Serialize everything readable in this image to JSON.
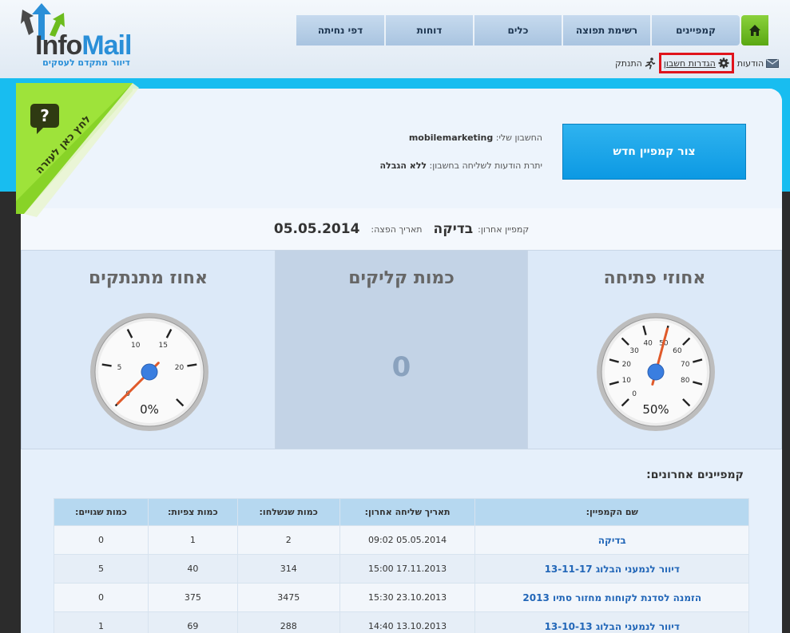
{
  "logo": {
    "word_a": "Info",
    "word_b": "Mail",
    "tagline": "דיוור מתקדם לעסקים"
  },
  "colors": {
    "accent": "#18bdf0",
    "home_green": "#6cbc1e",
    "nav_blue": "#b3cce6",
    "highlight": "#e0141c"
  },
  "nav": {
    "home_icon": "home-icon",
    "items": [
      "קמפיינים",
      "רשימת תפוצה",
      "כלים",
      "דוחות",
      "דפי נחיתה"
    ]
  },
  "subnav": {
    "messages": "הודעות",
    "settings": "הגדרות חשבון",
    "logout": "התנתק"
  },
  "help": {
    "label": "לחץ כאן לעזרה",
    "icon_glyph": "?"
  },
  "account": {
    "new_campaign": "צור קמפיין חדש",
    "account_label": "החשבון שלי:",
    "account_value": "mobilemarketing",
    "remaining_label": "יתרת הודעות לשליחה בחשבון:",
    "remaining_value": "ללא הגבלה"
  },
  "last_campaign": {
    "label": "קמפיין אחרון:",
    "name": "בדיקה",
    "date_label": "תאריך הפצה:",
    "date": "05.05.2014"
  },
  "stats": {
    "open": {
      "title": "אחוזי פתיחה",
      "display": "50%",
      "value": 50,
      "ticks": [
        "0",
        "10",
        "20",
        "30",
        "40",
        "50",
        "60",
        "70",
        "80"
      ]
    },
    "clicks": {
      "title": "כמות קליקים",
      "value": "0"
    },
    "unsub": {
      "title": "אחוז מתנתקים",
      "display": "0%",
      "value": 0,
      "ticks": [
        "0",
        "5",
        "10",
        "15",
        "20"
      ]
    }
  },
  "recent": {
    "title": "קמפיינים אחרונים:",
    "headers": [
      "שם הקמפיין:",
      "תאריך שליחה אחרון:",
      "כמות שנשלחו:",
      "כמות צפיות:",
      "כמות שגויים:"
    ],
    "rows": [
      [
        "בדיקה",
        "05.05.2014 09:02",
        "2",
        "1",
        "0"
      ],
      [
        "דיוור לנמעני הבלוג 13-11-17",
        "17.11.2013 15:00",
        "314",
        "40",
        "5"
      ],
      [
        "הזמנה לסדנת לקוחות מחזור סתיו 2013",
        "23.10.2013 15:30",
        "3475",
        "375",
        "0"
      ],
      [
        "דיוור לנמעני הבלוג 13-10-13",
        "13.10.2013 14:40",
        "288",
        "69",
        "1"
      ]
    ]
  }
}
